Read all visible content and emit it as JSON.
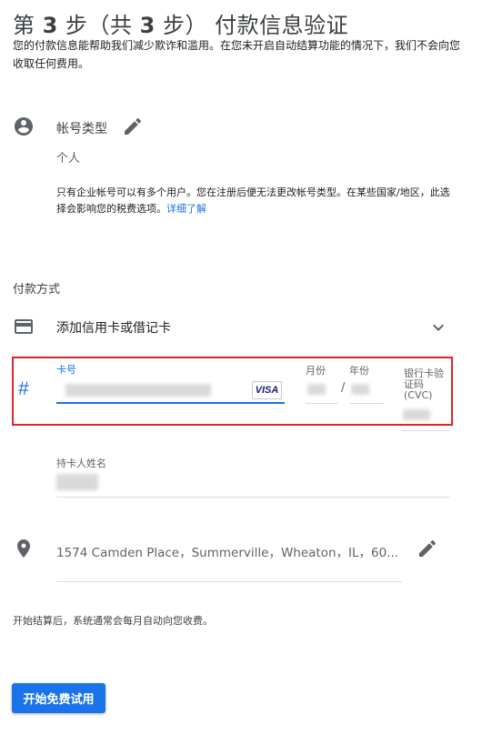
{
  "header": {
    "step_prefix": "第",
    "step_num": "3",
    "step_mid": "步（共",
    "total_num": "3",
    "step_suffix": "步） 付款信息验证",
    "intro": "您的付款信息能帮助我们减少欺诈和滥用。在您未开启自动结算功能的情况下，我们不会向您收取任何费用。"
  },
  "account": {
    "icon": "account-circle-icon",
    "label": "帐号类型",
    "value": "个人",
    "note": "只有企业帐号可以有多个用户。您在注册后便无法更改帐号类型。在某些国家/地区，此选择会影响您的税费选项。",
    "learn_more": "详细了解"
  },
  "payment": {
    "heading": "付款方式",
    "card_icon": "credit-card-icon",
    "add_card": "添加信用卡或借记卡",
    "card_number_label": "卡号",
    "card_brand": "VISA",
    "month_label": "月份",
    "year_label": "年份",
    "date_separator": "/",
    "cvc_label": "银行卡验证码 (CVC)",
    "holder_label": "持卡人姓名",
    "hash_symbol": "#"
  },
  "address": {
    "icon": "location-pin-icon",
    "text": "1574 Camden Place，Summerville，Wheaton，IL，60..."
  },
  "billing_note": "开始结算后，系统通常会每月自动向您收费。",
  "actions": {
    "start_trial": "开始免费试用"
  },
  "colors": {
    "accent": "#1a73e8",
    "highlight_border": "#e0242b",
    "icon_gray": "#5f6368"
  }
}
